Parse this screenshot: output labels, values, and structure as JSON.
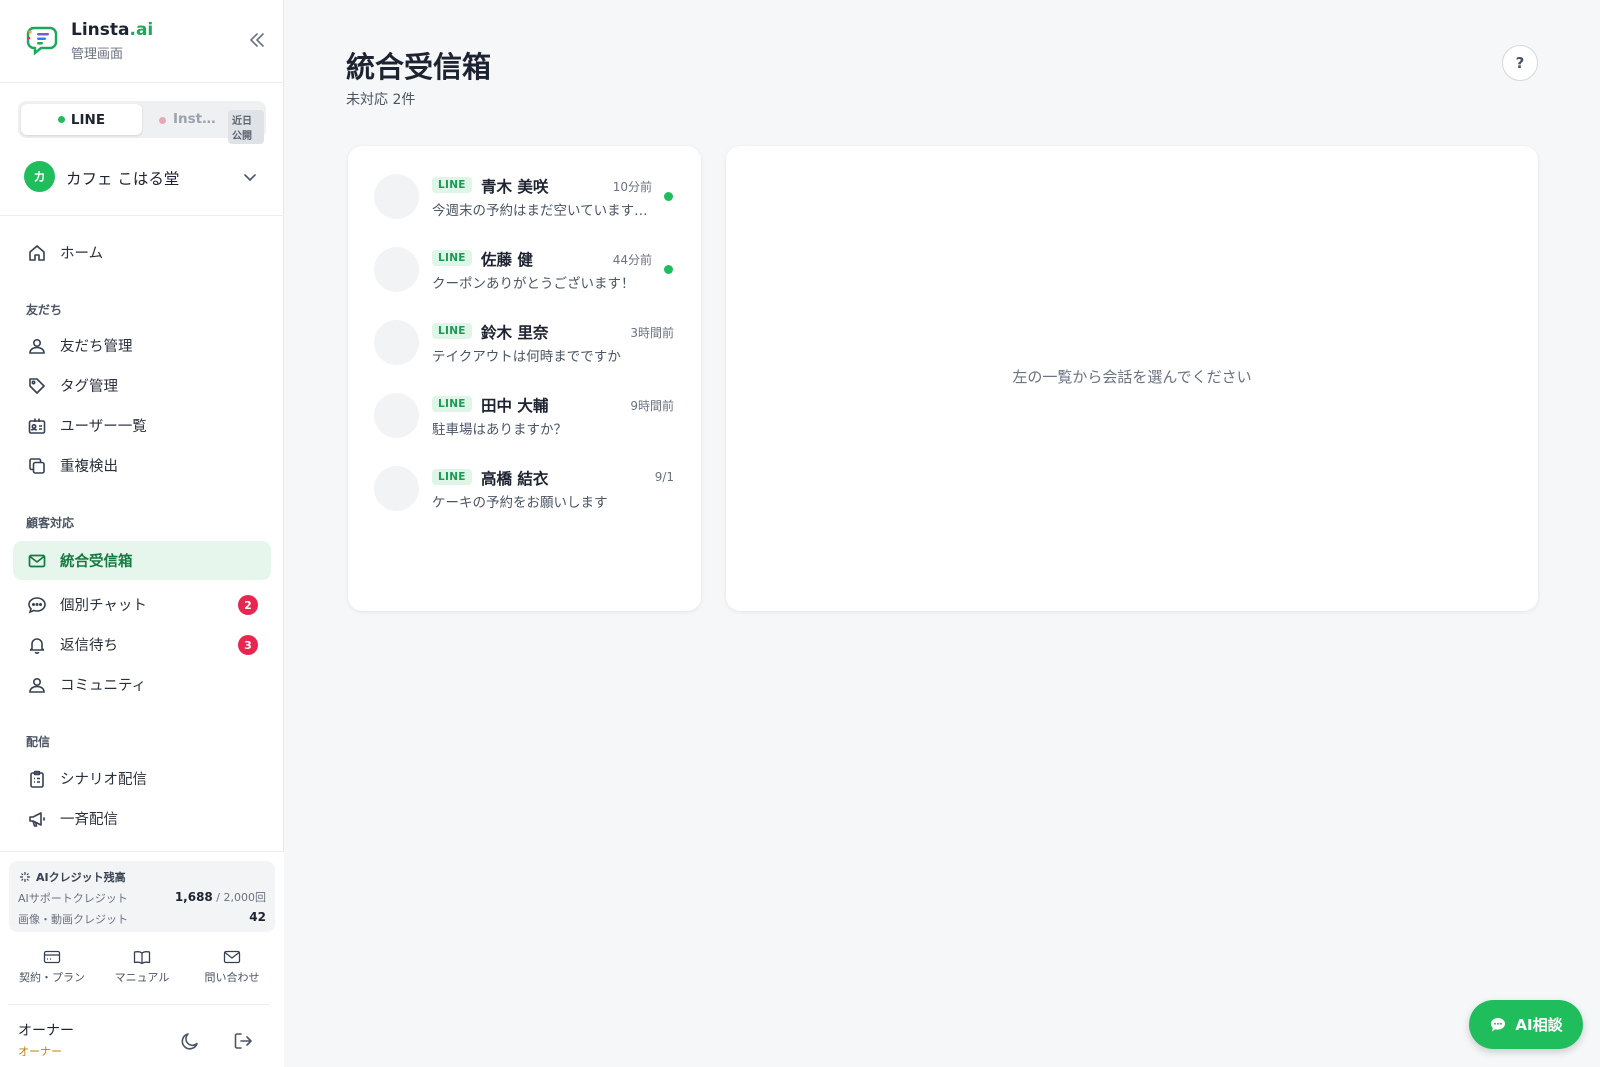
{
  "brand": {
    "name_main": "Linsta",
    "name_accent": ".ai",
    "subtitle": "管理画面"
  },
  "channels": {
    "line": "LINE",
    "instagram": "Inst…",
    "instagram_badge": "近日公開"
  },
  "account": {
    "initial": "カ",
    "name": "カフェ こはる堂"
  },
  "nav": {
    "home": "ホーム",
    "section_friends": "友だち",
    "friends_manage": "友だち管理",
    "tag_manage": "タグ管理",
    "user_list": "ユーザー一覧",
    "duplicate_detect": "重複検出",
    "section_customer": "顧客対応",
    "unified_inbox": "統合受信箱",
    "individual_chat": "個別チャット",
    "individual_chat_badge": "2",
    "awaiting_reply": "返信待ち",
    "awaiting_reply_badge": "3",
    "community": "コミュニティ",
    "section_delivery": "配信",
    "scenario_delivery": "シナリオ配信",
    "broadcast": "一斉配信"
  },
  "credits": {
    "title": "AIクレジット残高",
    "support_label": "AIサポートクレジット",
    "support_value": "1,688",
    "support_max": " / 2,000回",
    "media_label": "画像・動画クレジット",
    "media_value": "42"
  },
  "bottom_links": {
    "contract": "契約・プラン",
    "manual": "マニュアル",
    "contact": "問い合わせ"
  },
  "user": {
    "name": "オーナー",
    "role": "オーナー"
  },
  "main": {
    "title": "統合受信箱",
    "subtitle": "未対応 2件",
    "help": "?",
    "empty_message": "左の一覧から会話を選んでください"
  },
  "conversations": [
    {
      "channel": "LINE",
      "name": "青木 美咲",
      "time": "10分前",
      "message": "今週末の予約はまだ空いていますか？",
      "unread": true
    },
    {
      "channel": "LINE",
      "name": "佐藤 健",
      "time": "44分前",
      "message": "クーポンありがとうございます！",
      "unread": true
    },
    {
      "channel": "LINE",
      "name": "鈴木 里奈",
      "time": "3時間前",
      "message": "テイクアウトは何時までですか",
      "unread": false
    },
    {
      "channel": "LINE",
      "name": "田中 大輔",
      "time": "9時間前",
      "message": "駐車場はありますか？",
      "unread": false
    },
    {
      "channel": "LINE",
      "name": "高橋 結衣",
      "time": "9/1",
      "message": "ケーキの予約をお願いします",
      "unread": false
    }
  ],
  "ai_button": "AI相談",
  "colors": {
    "accent": "#1fbd5c",
    "badge": "#e8264f",
    "active_bg": "#e6f6ec",
    "owner_role": "#c77d0a"
  }
}
